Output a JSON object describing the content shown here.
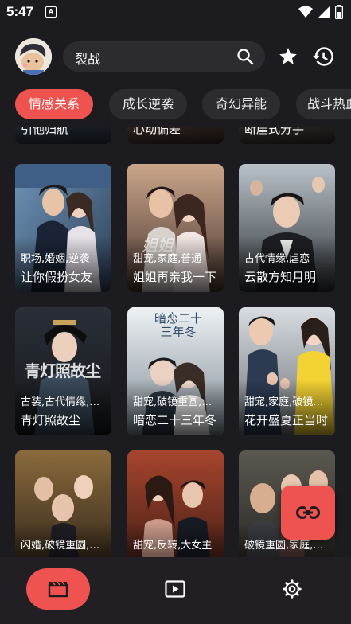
{
  "status_bar": {
    "time": "5:47",
    "notification_glyph": "A",
    "icons": [
      "wifi-icon",
      "signal-icon",
      "battery-icon"
    ]
  },
  "header": {
    "search_value": "裂战",
    "icons": [
      "avatar",
      "search-icon",
      "star-icon",
      "history-icon"
    ]
  },
  "tabs": [
    {
      "label": "情感关系",
      "active": true
    },
    {
      "label": "成长逆袭",
      "active": false
    },
    {
      "label": "奇幻异能",
      "active": false
    },
    {
      "label": "战斗热血",
      "active": false
    }
  ],
  "partial_row": [
    "引他归航",
    "心动偏差",
    "断崖式分手"
  ],
  "cards": [
    {
      "tags": "职场,婚姻,逆袭",
      "title": "让你假扮女友",
      "poster_text": ""
    },
    {
      "tags": "甜宠,家庭,普通",
      "title": "姐姐再亲我一下",
      "poster_text": "姐姐"
    },
    {
      "tags": "古代情缘,虐恋",
      "title": "云散方知月明",
      "poster_text": ""
    },
    {
      "tags": "古装,古代情缘,虐恋",
      "title": "青灯照故尘",
      "poster_text": "青灯照故尘"
    },
    {
      "tags": "甜宠,破镜重圆,虐恋",
      "title": "暗恋二十三年冬",
      "poster_text": "暗恋二十三年冬"
    },
    {
      "tags": "甜宠,家庭,破镜重圆",
      "title": "花开盛夏正当时",
      "poster_text": ""
    },
    {
      "tags": "闪婚,破镜重圆,逆袭",
      "title": "",
      "poster_text": ""
    },
    {
      "tags": "甜宠,反转,大女主",
      "title": "",
      "poster_text": ""
    },
    {
      "tags": "破镜重圆,家庭,逆袭",
      "title": "",
      "poster_text": ""
    }
  ],
  "fab": {
    "icon": "link-icon"
  },
  "bottom_nav": [
    {
      "icon": "film-icon",
      "active": true
    },
    {
      "icon": "play-icon",
      "active": false
    },
    {
      "icon": "gear-icon",
      "active": false
    }
  ],
  "colors": {
    "accent": "#ef5350",
    "background": "#1c1b1f",
    "surface": "#2c2b30"
  }
}
